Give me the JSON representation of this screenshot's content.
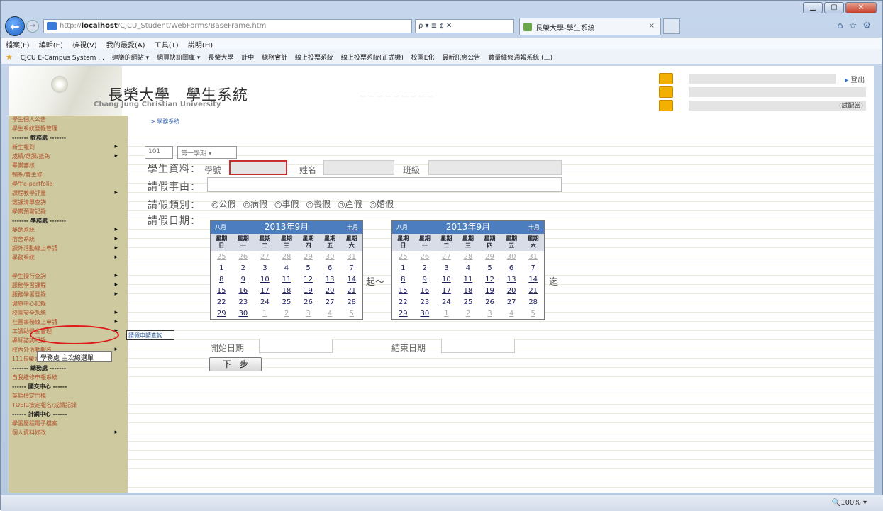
{
  "browser": {
    "url_prefix": "http://",
    "url_host": "localhost",
    "url_path": "/CJCU_Student/WebForms/BaseFrame.htm",
    "addr_tools": "ρ ▾ ≣ ¢ ✕",
    "tab_title": "長榮大學-學生系統",
    "tab_close": "×",
    "menu": [
      "檔案(F)",
      "編輯(E)",
      "檢視(V)",
      "我的最愛(A)",
      "工具(T)",
      "說明(H)"
    ],
    "favorites": [
      "CJCU E-Campus System ...",
      "建議的網站 ▾",
      "網頁快訊圖庫 ▾",
      "長榮大學",
      "計中",
      "總務會計",
      "線上投票系統",
      "線上投票系統(正式機)",
      "校園E化",
      "最新訊息公告",
      "數量維修通報系統 (三)"
    ],
    "zoom": "🔍100%  ▾"
  },
  "banner": {
    "title": "長榮大學　學生系統",
    "subtitle": "Chang Jung Christian University",
    "logout": "登出",
    "role": "(試配當)"
  },
  "breadcrumb": "> 學務系統",
  "sidebar": [
    {
      "label": "學生個人公告",
      "type": "item",
      "arrow": false
    },
    {
      "label": "學生系統登錄管理",
      "type": "item",
      "arrow": false
    },
    {
      "label": "------- 教務處 -------",
      "type": "sec",
      "arrow": false
    },
    {
      "label": "新生報到",
      "type": "item",
      "arrow": true
    },
    {
      "label": "成績/選課/抵免",
      "type": "item",
      "arrow": true
    },
    {
      "label": "畢業審核",
      "type": "item",
      "arrow": false
    },
    {
      "label": "輔系/雙主修",
      "type": "item",
      "arrow": false
    },
    {
      "label": "學生e-portfolio",
      "type": "item",
      "arrow": false
    },
    {
      "label": "課程教學評量",
      "type": "item",
      "arrow": true
    },
    {
      "label": "選課清單查詢",
      "type": "item",
      "arrow": false
    },
    {
      "label": "學業預警記錄",
      "type": "item",
      "arrow": false
    },
    {
      "label": "------- 學務處 -------",
      "type": "sec",
      "arrow": false
    },
    {
      "label": "獎助系統",
      "type": "item",
      "arrow": true
    },
    {
      "label": "宿舍系統",
      "type": "item",
      "arrow": true
    },
    {
      "label": "課外活動線上申請",
      "type": "item",
      "arrow": true
    },
    {
      "label": "學務系統",
      "type": "item",
      "arrow": true
    },
    {
      "label": "",
      "type": "item",
      "arrow": false
    },
    {
      "label": "學生操行查詢",
      "type": "item",
      "arrow": true
    },
    {
      "label": "服務學習課程",
      "type": "item",
      "arrow": true
    },
    {
      "label": "服務學習登錄",
      "type": "item",
      "arrow": true
    },
    {
      "label": "健康中心記錄",
      "type": "item",
      "arrow": false
    },
    {
      "label": "校園安全系統",
      "type": "item",
      "arrow": true
    },
    {
      "label": "社團事務線上申請",
      "type": "item",
      "arrow": true
    },
    {
      "label": "工讀助學金管理",
      "type": "item",
      "arrow": true
    },
    {
      "label": "導師諮詢紀錄",
      "type": "item",
      "arrow": false
    },
    {
      "label": "校內外活動報名",
      "type": "item",
      "arrow": true
    },
    {
      "label": "111長榮大學",
      "type": "item",
      "arrow": false
    },
    {
      "label": "------- 總務處 -------",
      "type": "sec",
      "arrow": false
    },
    {
      "label": "自我維修申報系統",
      "type": "item",
      "arrow": false
    },
    {
      "label": "------ 國交中心 ------",
      "type": "sec",
      "arrow": false
    },
    {
      "label": "英語檢定門檻",
      "type": "item",
      "arrow": false
    },
    {
      "label": "TOEIC檢定報名/成績記錄",
      "type": "item",
      "arrow": false
    },
    {
      "label": "------ 計網中心 ------",
      "type": "sec",
      "arrow": false
    },
    {
      "label": "學習歷程電子檔案",
      "type": "item",
      "arrow": false
    },
    {
      "label": "個人資料修改",
      "type": "item",
      "arrow": true
    }
  ],
  "popup_link": "請假申請查詢",
  "tooltip": "學務處 主次線選單",
  "form": {
    "year": "101",
    "semester": "第一學期 ▾",
    "student_info_label": "學生資料：",
    "student_id_label": "學號",
    "name_label": "姓名",
    "class_label": "班級",
    "reason_label": "請假事由：",
    "type_label": "請假類別：",
    "types": [
      "公假",
      "病假",
      "事假",
      "喪假",
      "產假",
      "婚假"
    ],
    "date_label": "請假日期：",
    "start_mark": "起～",
    "end_mark": "迄",
    "start_date_label": "開始日期",
    "end_date_label": "結束日期",
    "next_button": "下一步"
  },
  "calendar": {
    "title": "2013年9月",
    "prev": "八月",
    "next": "十月",
    "weekdays": [
      "星期\n日",
      "星期\n一",
      "星期\n二",
      "星期\n三",
      "星期\n四",
      "星期\n五",
      "星期\n六"
    ],
    "weeks": [
      [
        "25",
        "26",
        "27",
        "28",
        "29",
        "30",
        "31"
      ],
      [
        "1",
        "2",
        "3",
        "4",
        "5",
        "6",
        "7"
      ],
      [
        "8",
        "9",
        "10",
        "11",
        "12",
        "13",
        "14"
      ],
      [
        "15",
        "16",
        "17",
        "18",
        "19",
        "20",
        "21"
      ],
      [
        "22",
        "23",
        "24",
        "25",
        "26",
        "27",
        "28"
      ],
      [
        "29",
        "30",
        "1",
        "2",
        "3",
        "4",
        "5"
      ]
    ]
  }
}
